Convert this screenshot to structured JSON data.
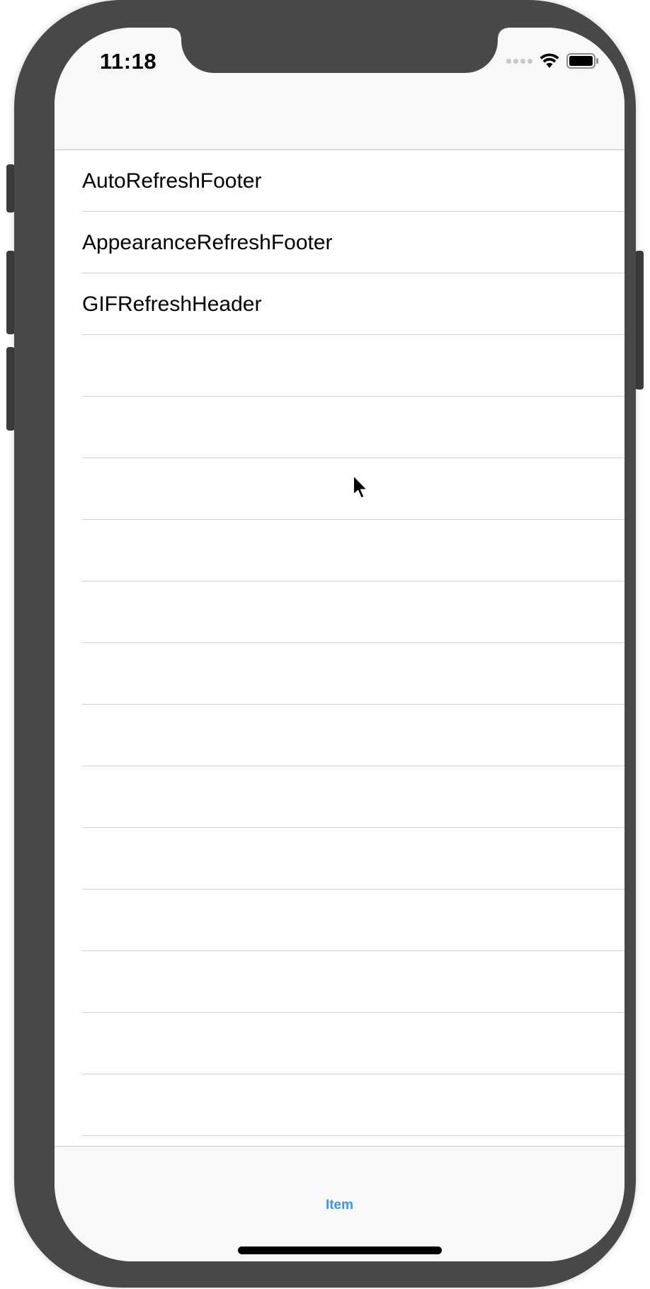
{
  "status_bar": {
    "time": "11:18"
  },
  "table": {
    "rows": [
      {
        "label": "AutoRefreshFooter"
      },
      {
        "label": "AppearanceRefreshFooter"
      },
      {
        "label": "GIFRefreshHeader"
      },
      {
        "label": ""
      },
      {
        "label": ""
      },
      {
        "label": ""
      },
      {
        "label": ""
      },
      {
        "label": ""
      },
      {
        "label": ""
      },
      {
        "label": ""
      },
      {
        "label": ""
      },
      {
        "label": ""
      },
      {
        "label": ""
      },
      {
        "label": ""
      },
      {
        "label": ""
      },
      {
        "label": ""
      }
    ]
  },
  "tab_bar": {
    "items": [
      {
        "label": "Item",
        "color": "#3a93f0"
      }
    ]
  },
  "icons": {
    "signal": "cellular-signal-icon",
    "wifi": "wifi-icon",
    "battery": "battery-icon",
    "cursor": "mouse-pointer-icon"
  },
  "colors": {
    "device": "#484848",
    "bar_background": "#f8f8f8",
    "separator": "#d2d2d6",
    "tint": "#3a93f0"
  }
}
